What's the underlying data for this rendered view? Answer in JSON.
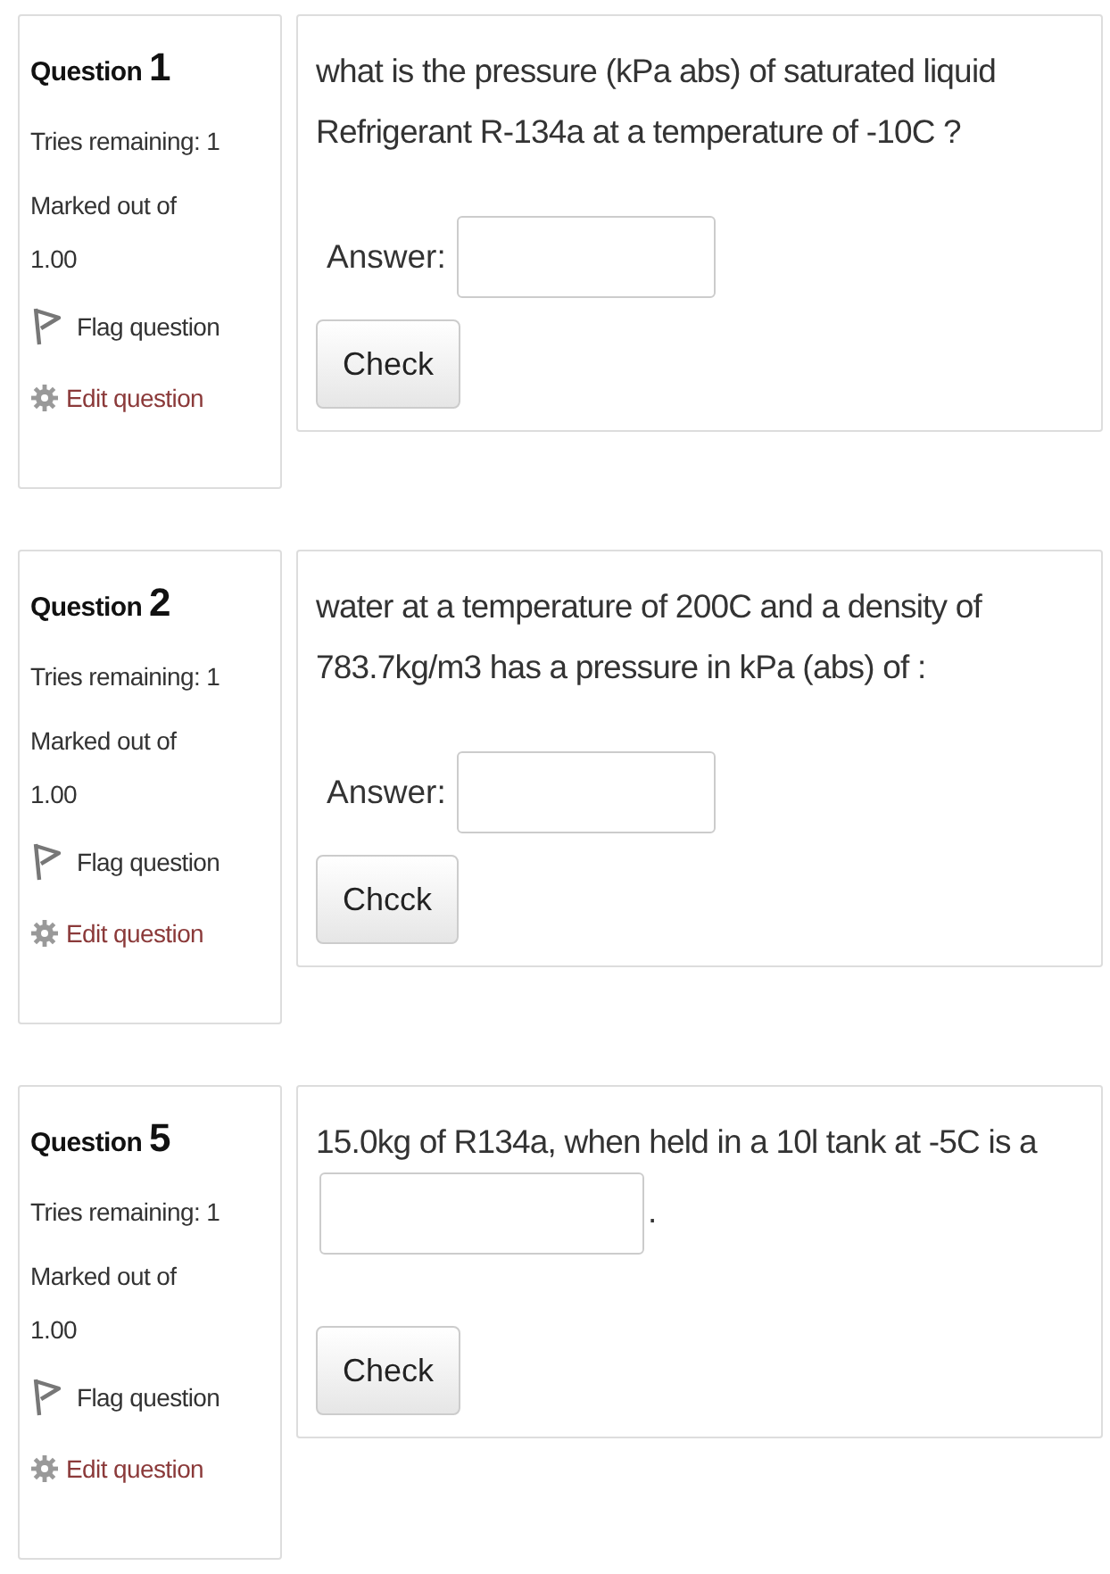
{
  "questions": [
    {
      "label": "Question",
      "number": "1",
      "tries": "Tries remaining: 1",
      "marked": "Marked out of",
      "mark": "1.00",
      "flag": "Flag question",
      "edit": "Edit question",
      "kind": "answer",
      "text": "what is the pressure (kPa abs) of saturated liquid Refrigerant R-134a at a temperature of -10C ?",
      "answer_label": "Answer:",
      "button": "Check"
    },
    {
      "label": "Question",
      "number": "2",
      "tries": "Tries remaining: 1",
      "marked": "Marked out of",
      "mark": "1.00",
      "flag": "Flag question",
      "edit": "Edit question",
      "kind": "answer",
      "text": "water at a temperature of 200C and a density of 783.7kg/m3 has a pressure in kPa (abs) of :",
      "answer_label": "Answer:",
      "button": "Chcck"
    },
    {
      "label": "Question",
      "number": "5",
      "tries": "Tries remaining: 1",
      "marked": "Marked out of",
      "mark": "1.00",
      "flag": "Flag question",
      "edit": "Edit question",
      "kind": "inline",
      "text_before": "15.0kg of R134a, when held in a 10l tank at -5C is a",
      "text_after": ".",
      "button": "Check"
    }
  ]
}
